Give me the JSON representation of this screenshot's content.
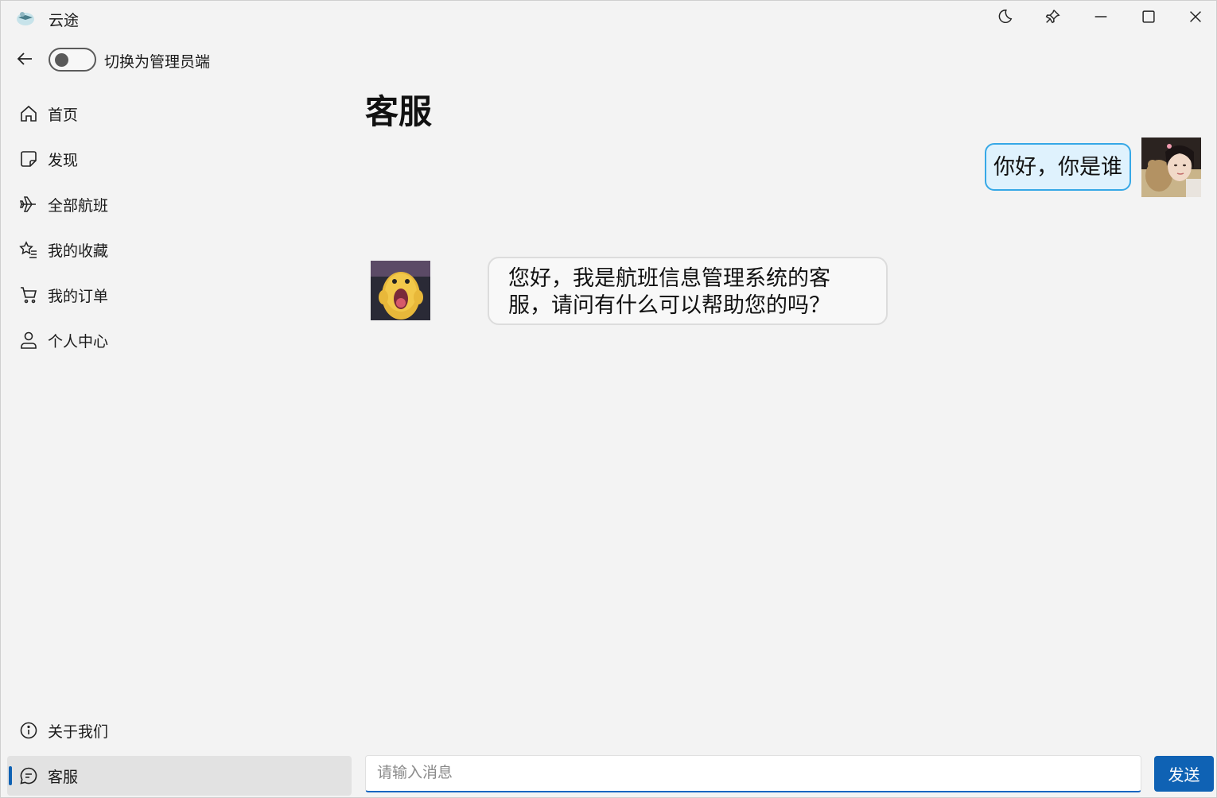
{
  "window": {
    "title": "云途"
  },
  "topbar": {
    "toggle_label": "切换为管理员端",
    "toggle_on": false
  },
  "nav": {
    "items": [
      {
        "label": "首页",
        "icon": "home-icon"
      },
      {
        "label": "发现",
        "icon": "sticky-note-icon"
      },
      {
        "label": "全部航班",
        "icon": "airplane-icon"
      },
      {
        "label": "我的收藏",
        "icon": "star-list-icon"
      },
      {
        "label": "我的订单",
        "icon": "cart-icon"
      },
      {
        "label": "个人中心",
        "icon": "person-icon"
      }
    ],
    "footer_items": [
      {
        "label": "关于我们",
        "icon": "info-icon"
      },
      {
        "label": "客服",
        "icon": "chat-icon",
        "selected": true
      }
    ]
  },
  "page": {
    "title": "客服"
  },
  "chat": {
    "messages": [
      {
        "sender": "user",
        "text": "你好，你是谁"
      },
      {
        "sender": "bot",
        "text": "您好，我是航班信息管理系统的客服，请问有什么可以帮助您的吗？"
      }
    ]
  },
  "composer": {
    "placeholder": "请输入消息",
    "value": "",
    "send_label": "发送"
  },
  "colors": {
    "accent": "#0f62b4",
    "user_bubble": "#dff2fd",
    "user_bubble_border": "#36a8e6"
  }
}
